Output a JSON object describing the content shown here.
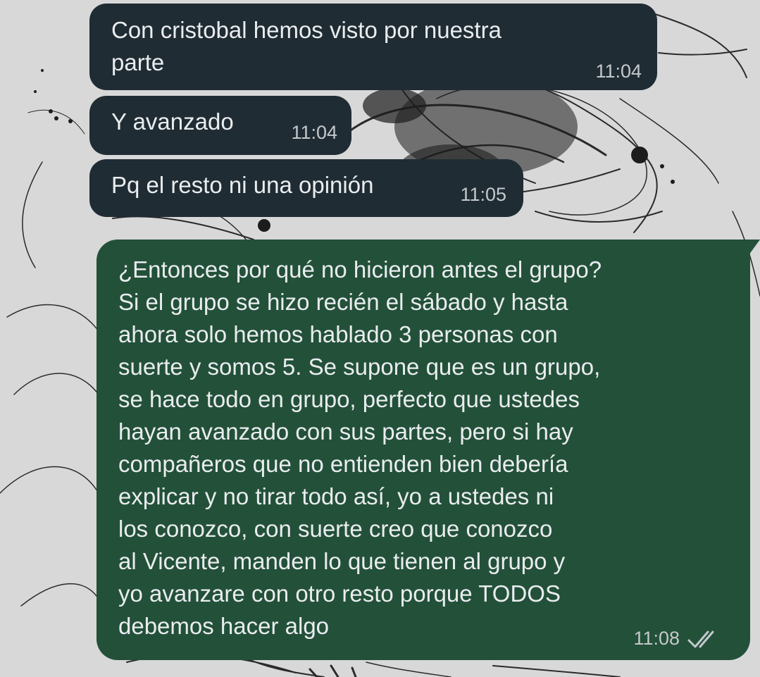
{
  "chat": {
    "messages": [
      {
        "direction": "incoming",
        "lines": [
          "Con cristobal hemos visto por nuestra",
          "parte"
        ],
        "time": "11:04"
      },
      {
        "direction": "incoming",
        "lines": [
          "Y avanzado"
        ],
        "time": "11:04"
      },
      {
        "direction": "incoming",
        "lines": [
          "Pq el resto ni una opinión"
        ],
        "time": "11:05"
      },
      {
        "direction": "outgoing",
        "lines": [
          "¿Entonces por qué no hicieron antes el grupo?",
          "Si el grupo se hizo recién el sábado y hasta",
          "ahora solo hemos hablado 3 personas con",
          "suerte y somos 5. Se supone que es un grupo,",
          "se hace todo en grupo, perfecto que ustedes",
          "hayan avanzado con sus partes, pero si hay",
          "compañeros que no entienden bien debería",
          "explicar y no tirar todo así, yo a ustedes ni",
          "los conozco, con suerte creo que conozco",
          "al Vicente, manden lo que tienen al grupo y",
          "yo avanzare con otro resto porque TODOS",
          "debemos hacer algo"
        ],
        "time": "11:08",
        "status_icon": "double-check-icon"
      }
    ]
  },
  "colors": {
    "incoming_bubble": "#202c33",
    "outgoing_bubble": "#235039",
    "text": "#e9edef",
    "timestamp": "#c3c8cb",
    "wallpaper": "#d9d9d9"
  }
}
